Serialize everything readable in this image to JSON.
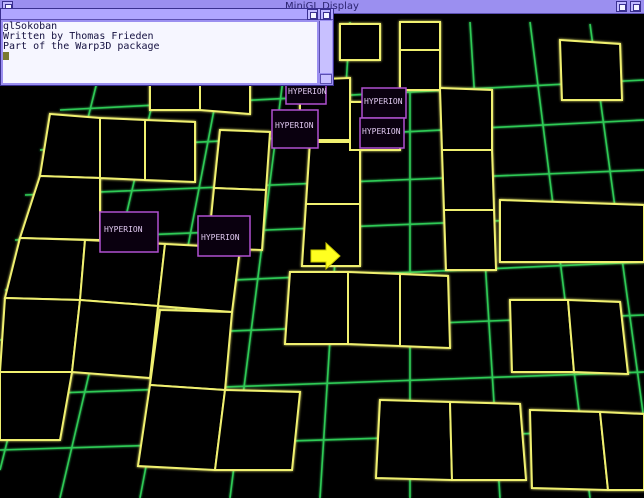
{
  "window": {
    "title": "MiniGL Display"
  },
  "console": {
    "lines": [
      "glSokoban",
      "Written by Thomas Frieden",
      "Part of the Warp3D package"
    ]
  },
  "game": {
    "box_label": "HYPERION",
    "boxes_count": 6,
    "colors": {
      "wall": "#e8e860",
      "floor_grid": "#30e060",
      "box": "#c060e0",
      "player": "#ffff20"
    }
  }
}
